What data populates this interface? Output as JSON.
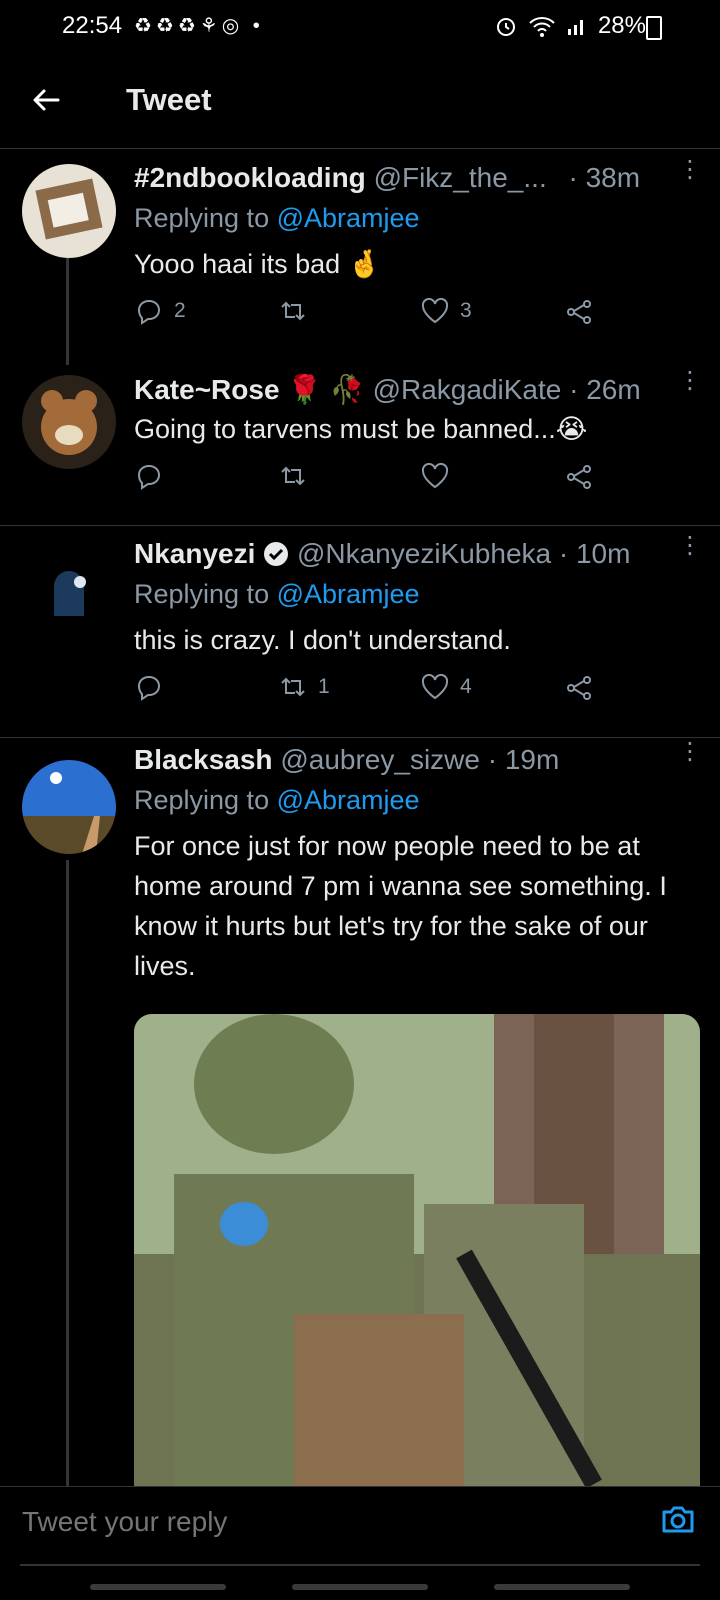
{
  "status": {
    "time": "22:54",
    "left_icons": "♻♻♻⚘◎ •",
    "battery": "28%"
  },
  "header": {
    "title": "Tweet"
  },
  "tweets": [
    {
      "name": "#2ndbookloading",
      "handle": "@Fikz_the_...",
      "time": "· 38m",
      "reply_label": "Replying to",
      "reply_mention": "@Abramjee",
      "text": "Yooo haai its bad 🤞",
      "reply_count": "2",
      "retweet_count": "",
      "like_count": "3"
    },
    {
      "name": "Kate~Rose 🌹 🥀",
      "handle": "@RakgadiKate",
      "time": "· 26m",
      "text": "Going to tarvens must be banned...😭",
      "reply_count": "",
      "retweet_count": "",
      "like_count": ""
    },
    {
      "name": "Nkanyezi",
      "handle": "@NkanyeziKubheka",
      "time": "· 10m",
      "reply_label": "Replying to",
      "reply_mention": "@Abramjee",
      "text": "this is crazy. I don't understand.",
      "reply_count": "",
      "retweet_count": "1",
      "like_count": "4"
    },
    {
      "name": "Blacksash",
      "handle": "@aubrey_sizwe",
      "time": "· 19m",
      "reply_label": "Replying to",
      "reply_mention": "@Abramjee",
      "text": "For once just for now people need to be at home around 7 pm i wanna see something. I know it hurts but let's try for the sake of our lives."
    }
  ],
  "reply_bar": {
    "placeholder": "Tweet your reply"
  },
  "colors": {
    "accent": "#1d9bf0",
    "muted": "#8b98a5",
    "divider": "#2f3336"
  }
}
